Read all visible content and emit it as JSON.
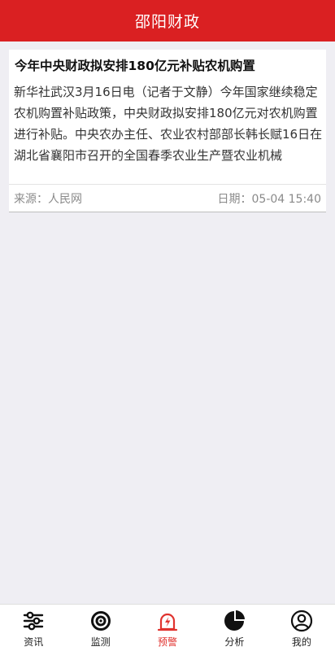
{
  "header": {
    "title": "邵阳财政"
  },
  "article": {
    "title": "今年中央财政拟安排180亿元补贴农机购置",
    "summary": "新华社武汉3月16日电（记者于文静）今年国家继续稳定农机购置补贴政策，中央财政拟安排180亿元对农机购置进行补贴。中央农办主任、农业农村部部长韩长赋16日在湖北省襄阳市召开的全国春季农业生产暨农业机械",
    "source": "来源：人民网",
    "date": "日期：05-04 15:40"
  },
  "tabbar": {
    "tabs": [
      {
        "label": "资讯",
        "icon": "sliders-icon"
      },
      {
        "label": "监测",
        "icon": "target-icon"
      },
      {
        "label": "预警",
        "icon": "alert-lightning-icon",
        "active": true
      },
      {
        "label": "分析",
        "icon": "pie-chart-icon"
      },
      {
        "label": "我的",
        "icon": "user-icon"
      }
    ],
    "active_color": "#e0332f"
  },
  "colors": {
    "header_bg": "#da2022",
    "page_bg": "#efeef3"
  }
}
